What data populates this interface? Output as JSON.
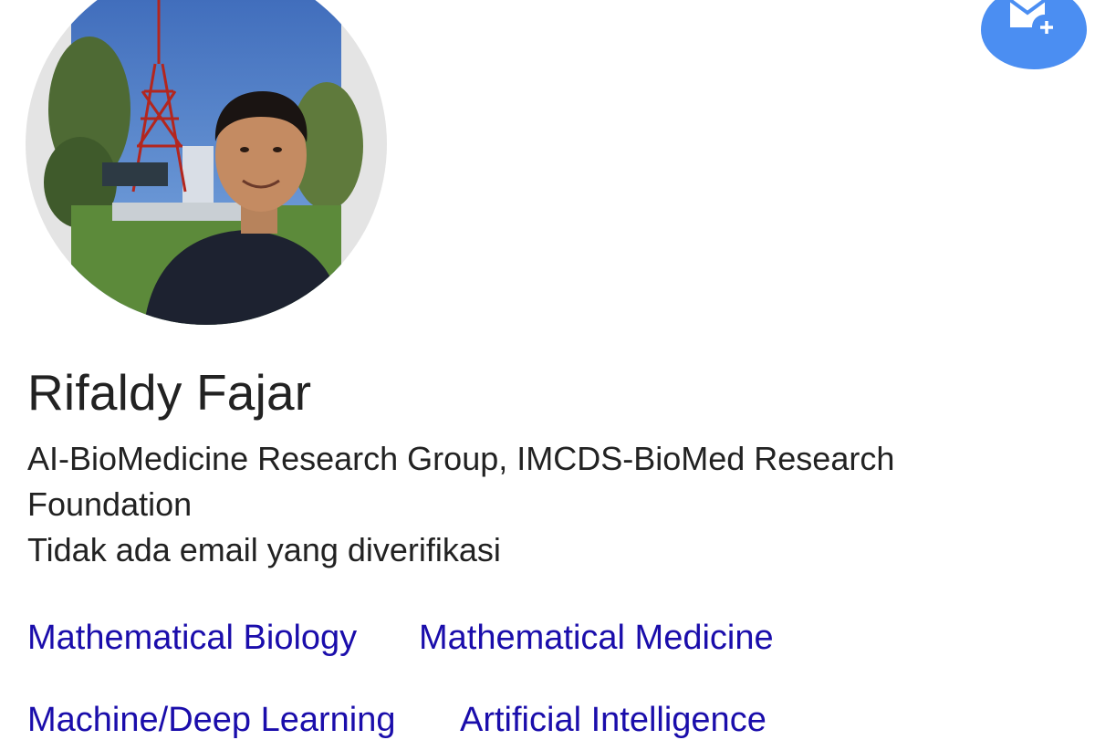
{
  "profile": {
    "name": "Rifaldy Fajar",
    "affiliation": "AI-BioMedicine Research Group, IMCDS-BioMed Research Foundation",
    "email_status": "Tidak ada email yang diverifikasi",
    "avatar_alt": "profile-photo",
    "follow_icon": "mail-add-icon"
  },
  "interests": [
    "Mathematical Biology",
    "Mathematical Medicine",
    "Machine/Deep Learning",
    "Artificial Intelligence"
  ],
  "colors": {
    "link": "#1a0dab",
    "follow_button": "#4b8ef2",
    "avatar_ring": "#e4e4e4",
    "text": "#222222"
  }
}
